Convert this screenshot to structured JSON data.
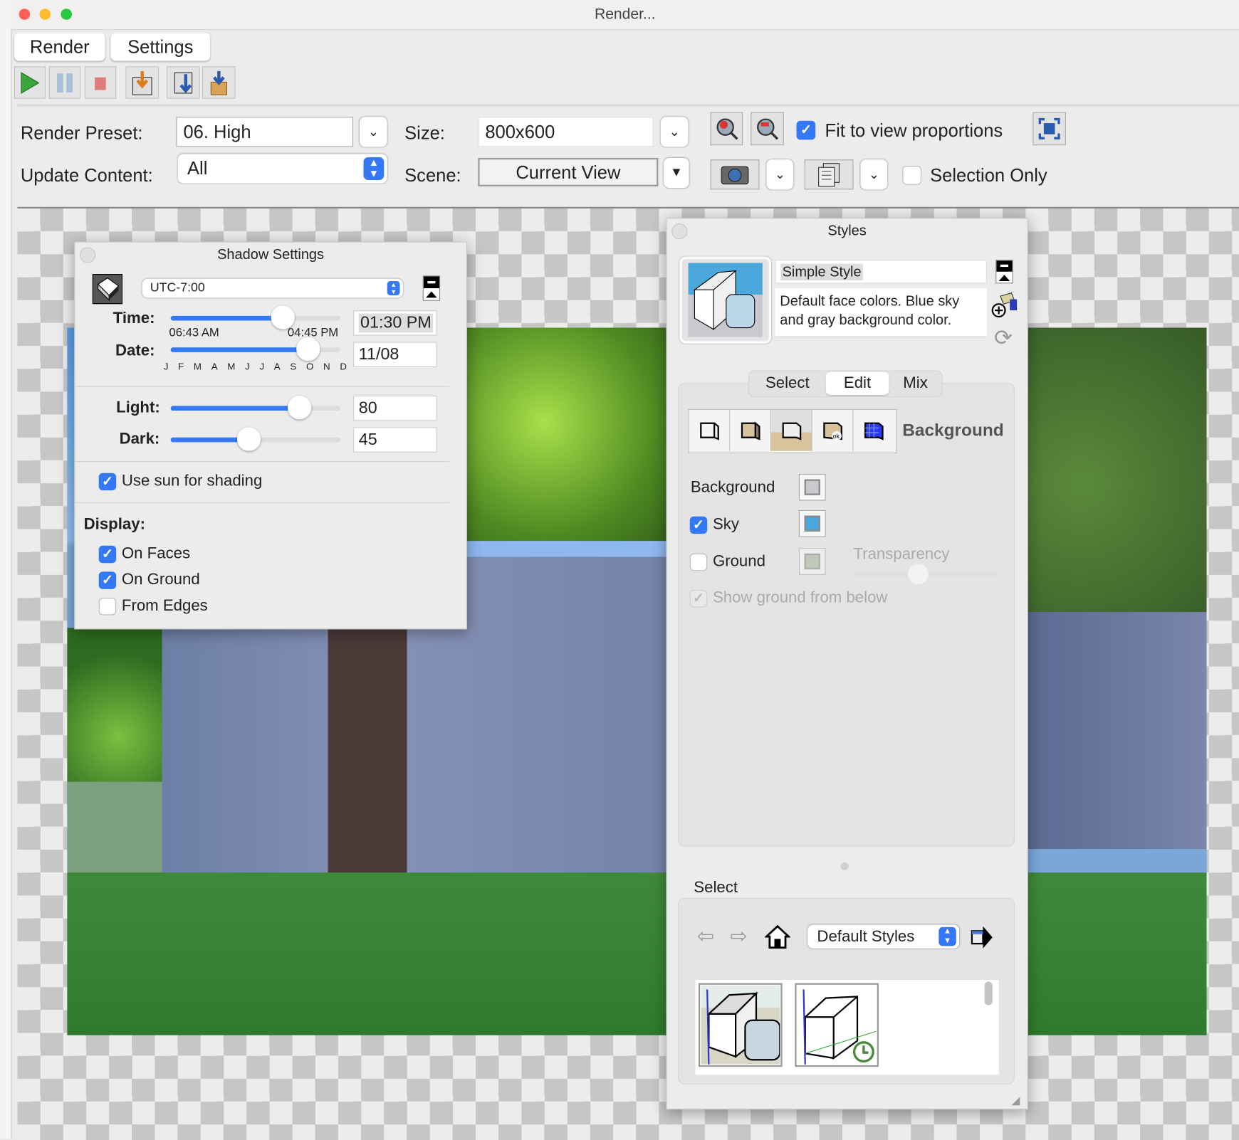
{
  "window": {
    "title": "Render..."
  },
  "tabs": [
    {
      "label": "Render"
    },
    {
      "label": "Settings"
    }
  ],
  "toolbar": {
    "icons": [
      "play-icon",
      "pause-icon",
      "stop-icon",
      "export-image-icon",
      "export-settings-icon",
      "import-icon"
    ]
  },
  "settings": {
    "render_preset": {
      "label": "Render Preset:",
      "value": "06. High"
    },
    "size": {
      "label": "Size:",
      "value": "800x600"
    },
    "fit_to_view": {
      "label": "Fit to view proportions",
      "checked": true
    },
    "update_content": {
      "label": "Update Content:",
      "value": "All"
    },
    "scene": {
      "label": "Scene:",
      "value": "Current View"
    },
    "selection_only": {
      "label": "Selection Only",
      "checked": false
    }
  },
  "shadow": {
    "title": "Shadow Settings",
    "timezone": "UTC-7:00",
    "time": {
      "label": "Time:",
      "value": "01:30 PM",
      "range_start": "06:43 AM",
      "range_end": "04:45 PM",
      "slider_fraction": 0.66
    },
    "date": {
      "label": "Date:",
      "value": "11/08",
      "months": [
        "J",
        "F",
        "M",
        "A",
        "M",
        "J",
        "J",
        "A",
        "S",
        "O",
        "N",
        "D"
      ],
      "slider_fraction": 0.81
    },
    "light": {
      "label": "Light:",
      "value": "80",
      "slider_fraction": 0.76
    },
    "dark": {
      "label": "Dark:",
      "value": "45",
      "slider_fraction": 0.46
    },
    "use_sun": {
      "label": "Use sun for shading",
      "checked": true
    },
    "display": {
      "label": "Display:",
      "options": [
        {
          "label": "On Faces",
          "checked": true
        },
        {
          "label": "On Ground",
          "checked": true
        },
        {
          "label": "From Edges",
          "checked": false
        }
      ]
    }
  },
  "styles": {
    "title": "Styles",
    "style_name": "Simple Style",
    "description": "Default face colors. Blue sky and gray background color.",
    "tabs": [
      {
        "label": "Select"
      },
      {
        "label": "Edit",
        "active": true
      },
      {
        "label": "Mix"
      }
    ],
    "section_title": "Background",
    "background": {
      "label": "Background",
      "color": "#c9c9d0"
    },
    "sky": {
      "label": "Sky",
      "checked": true,
      "color": "#47a8dc"
    },
    "ground": {
      "label": "Ground",
      "checked": false,
      "color": "#a9b89c"
    },
    "transparency": {
      "label": "Transparency",
      "slider_fraction": 0.45
    },
    "show_ground_below": {
      "label": "Show ground from below",
      "checked": true,
      "disabled": true
    },
    "select_label": "Select",
    "collection": "Default Styles"
  }
}
